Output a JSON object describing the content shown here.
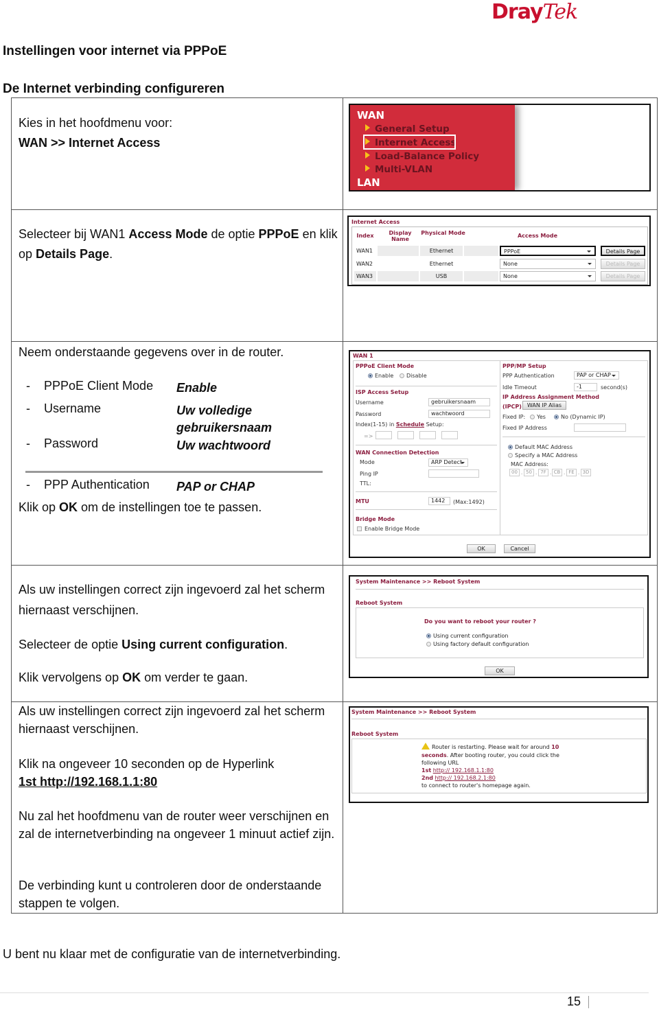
{
  "brand": {
    "part1": "Dray",
    "part2": "Tek",
    "color": "#c8102e"
  },
  "doc": {
    "title": "Instellingen voor internet via PPPoE",
    "section_title": "De Internet verbinding configureren",
    "closing": "U bent nu klaar met de configuratie van de internetverbinding.",
    "page_number": "15"
  },
  "steps": {
    "step1": {
      "line1": "Kies in het hoofdmenu voor:",
      "line2": "WAN >> Internet Access"
    },
    "step2": {
      "t1": "Selecteer bij WAN1 ",
      "b1": "Access Mode",
      "t2": " de optie ",
      "b2": "PPPoE",
      "t3": " en klik op ",
      "b3": "Details Page",
      "t4": "."
    },
    "step3": {
      "intro": "Neem onderstaande gegevens over in de router.",
      "items": [
        {
          "dash": "-",
          "key": "PPPoE Client Mode",
          "value": "Enable"
        },
        {
          "dash": "-",
          "key": "Username",
          "value": "Uw volledige",
          "value2": "gebruikersnaam"
        },
        {
          "dash": "-",
          "key": "Password",
          "value": "Uw wachtwoord"
        },
        {
          "dash": "-",
          "key": "PPP Authentication",
          "value": "PAP or CHAP"
        }
      ],
      "outro_t1": "Klik op ",
      "outro_b": "OK",
      "outro_t2": " om de instellingen toe te passen."
    },
    "step4": {
      "line1": "Als uw instellingen correct zijn ingevoerd zal het scherm hiernaast verschijnen.",
      "line2_t": "Selecteer de optie ",
      "line2_b": "Using current configuration",
      "line2_end": ".",
      "line3_t": "Klik vervolgens op ",
      "line3_b": "OK",
      "line3_end": " om verder te gaan."
    },
    "step5": {
      "line1": "Als uw instellingen correct zijn ingevoerd zal het scherm hiernaast verschijnen.",
      "line2": "Klik na ongeveer 10 seconden op de Hyperlink",
      "link": "1st http://192.168.1.1:80"
    },
    "step6": {
      "line1": "Nu zal het hoofdmenu van de router weer verschijnen en zal de internetverbinding na ongeveer 1 minuut actief zijn.",
      "line2": "De verbinding kunt u controleren door de onderstaande stappen te volgen."
    }
  },
  "screens": {
    "wan_menu": {
      "header": "WAN",
      "items": [
        "General Setup",
        "Internet Access",
        "Load-Balance Policy",
        "Multi-VLAN"
      ],
      "highlighted": "Internet Access",
      "footer": "LAN",
      "menu_color": "#d12c3b"
    },
    "internet_access": {
      "title": "Internet Access",
      "headers": [
        "Index",
        "Display Name",
        "Physical Mode",
        "Access Mode"
      ],
      "rows": [
        {
          "index": "WAN1",
          "display_name": "",
          "physical_mode": "Ethernet",
          "access_mode": "PPPoE",
          "button": "Details Page",
          "enabled": true
        },
        {
          "index": "WAN2",
          "display_name": "",
          "physical_mode": "Ethernet",
          "access_mode": "None",
          "button": "Details Page",
          "enabled": false
        },
        {
          "index": "WAN3",
          "display_name": "",
          "physical_mode": "USB",
          "access_mode": "None",
          "button": "Details Page",
          "enabled": false
        }
      ]
    },
    "wan1": {
      "title": "WAN 1",
      "pppoe_client_mode": {
        "label": "PPPoE Client Mode",
        "options": [
          "Enable",
          "Disable"
        ],
        "selected": "Enable"
      },
      "isp": {
        "label": "ISP Access Setup",
        "username_label": "Username",
        "username": "gebruikersnaam",
        "password_label": "Password",
        "password": "wachtwoord",
        "schedule_pre": "Index(1-15) in ",
        "schedule_link": "Schedule",
        "schedule_post": " Setup:",
        "arrow": "=>"
      },
      "detection": {
        "label": "WAN Connection Detection",
        "mode_label": "Mode",
        "mode": "ARP Detect",
        "ping_label": "Ping IP",
        "ping": "",
        "ttl_label": "TTL:"
      },
      "mtu": {
        "label": "MTU",
        "value": "1442",
        "max": "(Max:1492)"
      },
      "bridge": {
        "label": "Bridge Mode",
        "option": "Enable Bridge Mode",
        "checked": false
      },
      "ppp": {
        "label": "PPP/MP Setup",
        "auth_label": "PPP Authentication",
        "auth": "PAP or CHAP",
        "idle_label": "Idle Timeout",
        "idle": "-1",
        "idle_unit": "second(s)"
      },
      "ip": {
        "label": "IP Address Assignment Method",
        "ipcp": "(IPCP)",
        "alias_button": "WAN IP Alias",
        "fixed_label": "Fixed IP:",
        "fixed_yes": "Yes",
        "fixed_no": "No (Dynamic IP)",
        "fixed_selected": "No",
        "fixed_addr_label": "Fixed IP Address",
        "fixed_addr": ""
      },
      "mac": {
        "default": "Default MAC Address",
        "specify": "Specify a MAC Address",
        "selected": "Default",
        "label": "MAC Address:",
        "octets": [
          "00",
          "50",
          "7F",
          "CB",
          "FE",
          "3D"
        ]
      },
      "ok": "OK",
      "cancel": "Cancel"
    },
    "reboot_confirm": {
      "breadcrumb": "System Maintenance >> Reboot System",
      "section": "Reboot System",
      "question": "Do you want to reboot your router ?",
      "options": [
        "Using current configuration",
        "Using factory default configuration"
      ],
      "selected": "Using current configuration",
      "ok": "OK"
    },
    "reboot_progress": {
      "breadcrumb": "System Maintenance >> Reboot System",
      "section": "Reboot System",
      "msg1": "Router is restarting. Please wait for around ",
      "msg1_num": "10",
      "msg2_b": "seconds",
      "msg2": ". After booting router, you could click the",
      "msg3": "following URL",
      "link1_label": "1st",
      "link1": "http:// 192.168.1.1:80",
      "link2_label": "2nd",
      "link2": "http:// 192.168.2.1:80",
      "msg4": "to connect to router's homepage again."
    }
  }
}
